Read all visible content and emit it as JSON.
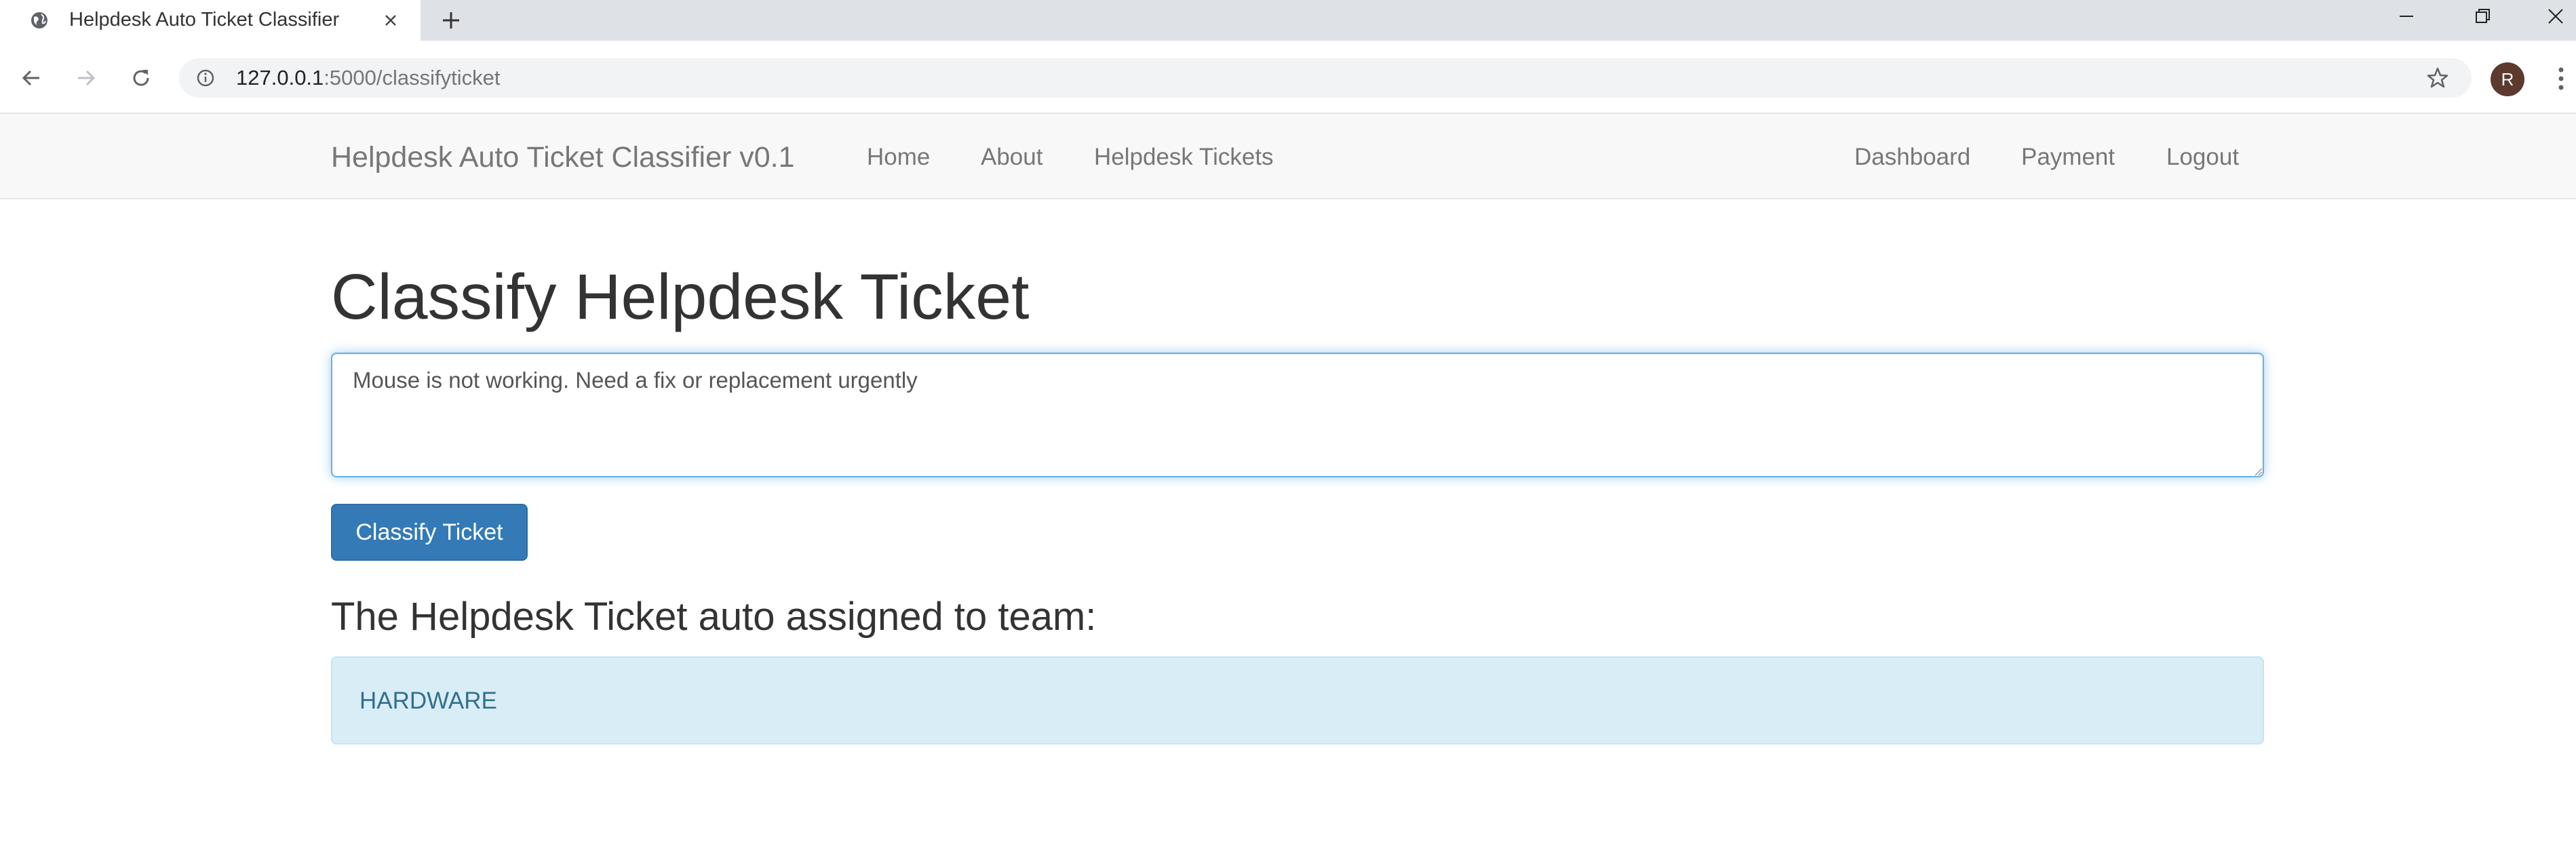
{
  "browser": {
    "tab_title": "Helpdesk Auto Ticket Classifier",
    "url_host": "127.0.0.1",
    "url_rest": ":5000/classifyticket",
    "profile_initial": "R"
  },
  "navbar": {
    "brand": "Helpdesk Auto Ticket Classifier v0.1",
    "left_links": [
      "Home",
      "About",
      "Helpdesk Tickets"
    ],
    "right_links": [
      "Dashboard",
      "Payment",
      "Logout"
    ]
  },
  "main": {
    "title": "Classify Helpdesk Ticket",
    "ticket_text": "Mouse is not working. Need a fix or replacement urgently",
    "classify_button": "Classify Ticket",
    "result_heading": "The Helpdesk Ticket auto assigned to team:",
    "result_team": "HARDWARE"
  },
  "icons": {
    "favicon": "globe-icon",
    "tab_close": "close-icon",
    "new_tab": "plus-icon",
    "back": "arrow-left-icon",
    "forward": "arrow-right-icon",
    "reload": "reload-icon",
    "site_info": "info-icon",
    "bookmark": "star-icon",
    "menu": "kebab-menu-icon"
  },
  "colors": {
    "primary_button": "#337ab7",
    "alert_info_bg": "#d9edf7",
    "alert_info_text": "#31708f",
    "focus_border": "#66afe9"
  }
}
